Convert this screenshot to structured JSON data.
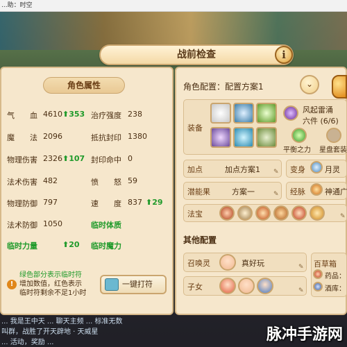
{
  "os_bar": {
    "title": "...助：时空"
  },
  "chat": {
    "line1": "...  我是王中天 ...   聊天主频 ... 标准无数",
    "line2": "叫群，战胜了开天辟地 · 天威星",
    "line3": "... 活动，奖励 ..."
  },
  "watermark": "脉冲手游网",
  "dialog": {
    "title": "战前检查",
    "info_label": "i"
  },
  "attributes": {
    "header": "角色属性",
    "rows": [
      {
        "name": "气　　血",
        "value": "4610",
        "bonus": "353"
      },
      {
        "name": "治疗强度",
        "value": "238",
        "bonus": ""
      },
      {
        "name": "魔　　法",
        "value": "2096",
        "bonus": ""
      },
      {
        "name": "抵抗封印",
        "value": "1380",
        "bonus": ""
      },
      {
        "name": "物理伤害",
        "value": "2326",
        "bonus": "107"
      },
      {
        "name": "封印命中",
        "value": "0",
        "bonus": ""
      },
      {
        "name": "法术伤害",
        "value": "482",
        "bonus": ""
      },
      {
        "name": "愤　　怒",
        "value": "59",
        "bonus": ""
      },
      {
        "name": "物理防御",
        "value": "797",
        "bonus": ""
      },
      {
        "name": "速　　度",
        "value": "837",
        "bonus": "29"
      },
      {
        "name": "法术防御",
        "value": "1050",
        "bonus": ""
      },
      {
        "name": "临时体质",
        "value": "",
        "bonus": ""
      },
      {
        "name": "临时力量",
        "value": "",
        "bonus": "20"
      },
      {
        "name": "临时魔力",
        "value": "",
        "bonus": ""
      }
    ],
    "note_line1": "绿色部分表示临时符",
    "note_line2": "增加数值，红色表示",
    "note_line3": "临时符剩余不足1小时",
    "onekey_label": "一键打符",
    "arrow": "⬆"
  },
  "config": {
    "title": "角色配置：配置方案1",
    "equip_label": "装备",
    "set_name": "风起雷涌",
    "set_count": "六件 (6/6)",
    "balance_label": "平衡之力",
    "starplate_label": "星盘套装",
    "addpoint_label": "加点",
    "addpoint_value": "加点方案1",
    "transform_label": "变身",
    "transform_value": "月灵",
    "potential_label": "潜能果",
    "potential_value": "方案一",
    "meridian_label": "经脉",
    "meridian_value": "神通广",
    "treasure_label": "法宝",
    "other_header": "其他配置",
    "summon_label": "召唤灵",
    "summon_value": "真好玩",
    "child_label": "子女",
    "box_label": "百草箱",
    "medicine_label": "药品：",
    "wine_label": "酒库："
  },
  "colors": {
    "panel_bg": "#f6e7cc",
    "bonus_green": "#1f9a2a",
    "text_brown": "#4a2e12"
  }
}
